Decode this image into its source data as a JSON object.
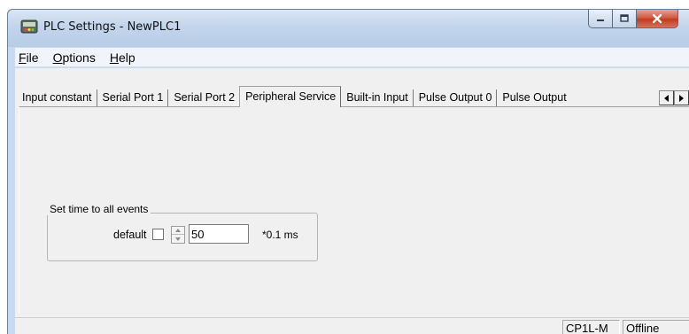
{
  "window": {
    "title": "PLC Settings - NewPLC1",
    "buttons": {
      "minimize": "minimize",
      "maximize": "maximize",
      "close": "close"
    }
  },
  "menu": {
    "items": [
      {
        "mnemonic": "F",
        "rest": "ile"
      },
      {
        "mnemonic": "O",
        "rest": "ptions"
      },
      {
        "mnemonic": "H",
        "rest": "elp"
      }
    ]
  },
  "tabs": [
    {
      "label": "Input constant"
    },
    {
      "label": "Serial Port 1"
    },
    {
      "label": "Serial Port 2"
    },
    {
      "label": "Peripheral Service",
      "active": true
    },
    {
      "label": "Built-in Input"
    },
    {
      "label": "Pulse Output 0"
    },
    {
      "label": "Pulse Output"
    }
  ],
  "peripheral": {
    "group_title": "Set time to all events",
    "default_label": "default",
    "default_checked": false,
    "value": "50",
    "unit": "*0.1 ms"
  },
  "status": {
    "model": "CP1L-M",
    "connection": "Offline"
  },
  "icons": {
    "app": "plc-icon",
    "tab_scroll_left": "arrow-left-icon",
    "tab_scroll_right": "arrow-right-icon"
  },
  "colors": {
    "close_button": "#c5391f",
    "title_bar": "#c3d5ec"
  }
}
